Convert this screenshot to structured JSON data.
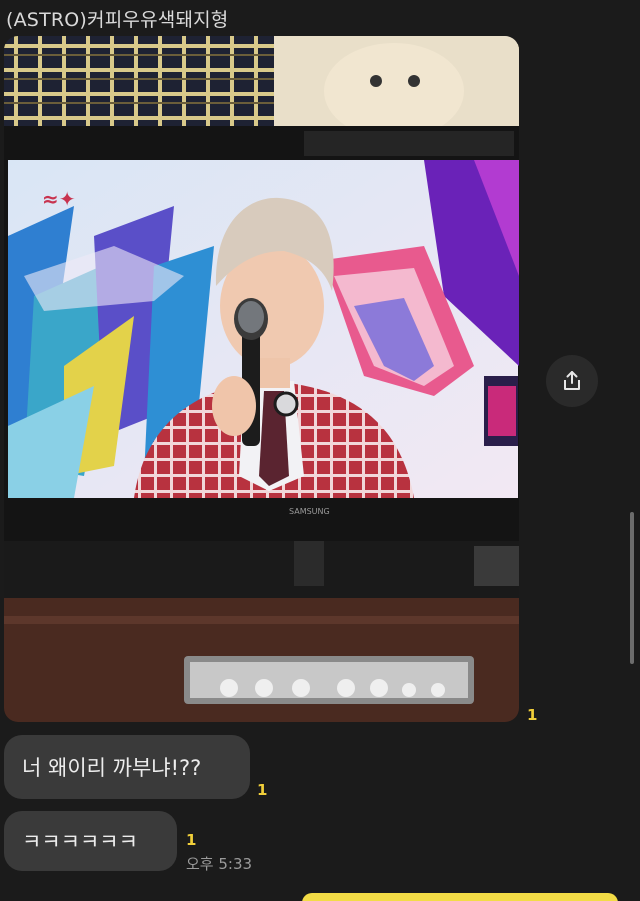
{
  "chat": {
    "sender_name": "(ASTRO)커피우유색돼지형",
    "messages": [
      {
        "type": "photo",
        "unread": "1"
      },
      {
        "type": "text",
        "text": "너 왜이리 까부냐!??",
        "unread": "1"
      },
      {
        "type": "text",
        "text": "ㅋㅋㅋㅋㅋㅋ",
        "unread": "1",
        "time": "오후 5:33"
      }
    ]
  },
  "photo": {
    "tv_brand": "SAMSUNG"
  },
  "icons": {
    "share": "share-icon"
  },
  "colors": {
    "background": "#1b1b1b",
    "bubble": "#3a3a3a",
    "unread": "#f1cf3a",
    "my_bubble": "#f3dc46"
  }
}
